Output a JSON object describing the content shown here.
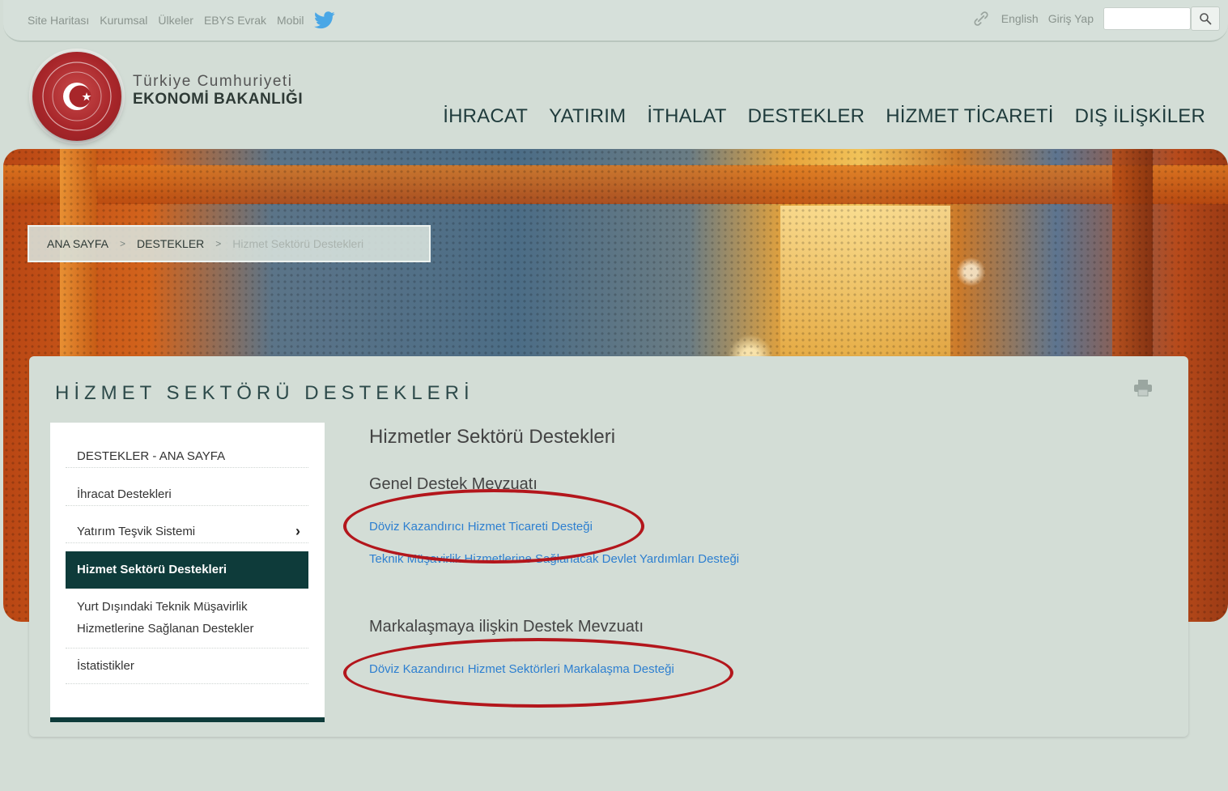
{
  "top_links": [
    "Site Haritası",
    "Kurumsal",
    "Ülkeler",
    "EBYS Evrak",
    "Mobil"
  ],
  "top_right": {
    "english": "English",
    "login": "Giriş Yap"
  },
  "brand": {
    "line1": "Türkiye Cumhuriyeti",
    "line2": "EKONOMİ BAKANLIĞI"
  },
  "main_nav": [
    "İHRACAT",
    "YATIRIM",
    "İTHALAT",
    "DESTEKLER",
    "HİZMET TİCARETİ",
    "DIŞ İLİŞKİLER"
  ],
  "breadcrumb": {
    "home": "ANA SAYFA",
    "parent": "DESTEKLER",
    "current": "Hizmet Sektörü Destekleri",
    "separator": ">"
  },
  "page_title": "HİZMET SEKTÖRÜ DESTEKLERİ",
  "sidebar": [
    {
      "label": "DESTEKLER - ANA SAYFA"
    },
    {
      "label": "İhracat Destekleri"
    },
    {
      "label": "Yatırım Teşvik Sistemi",
      "chevron": "›"
    },
    {
      "label": "Hizmet Sektörü Destekleri",
      "active": true
    },
    {
      "label_line1": "Yurt Dışındaki Teknik Müşavirlik",
      "label_line2": "Hizmetlerine Sağlanan Destekler"
    },
    {
      "label": "İstatistikler"
    }
  ],
  "content": {
    "heading": "Hizmetler Sektörü Destekleri",
    "section1": {
      "title": "Genel Destek Mevzuatı",
      "links": [
        "Döviz Kazandırıcı Hizmet Ticareti Desteği",
        "Teknik Müşavirlik Hizmetlerine Sağlanacak Devlet Yardımları Desteği"
      ]
    },
    "section2": {
      "title": "Markalaşmaya ilişkin Destek Mevzuatı",
      "links": [
        "Döviz Kazandırıcı Hizmet Sektörleri Markalaşma Desteği"
      ]
    }
  },
  "colors": {
    "accent_dark": "#0e3b3a",
    "link": "#2d7fd0",
    "annotation": "#b3161c",
    "twitter": "#4aa7e6"
  },
  "icons": [
    "twitter-icon",
    "link-icon",
    "search-icon",
    "print-icon",
    "chevron-right-icon",
    "seal-emblem"
  ]
}
